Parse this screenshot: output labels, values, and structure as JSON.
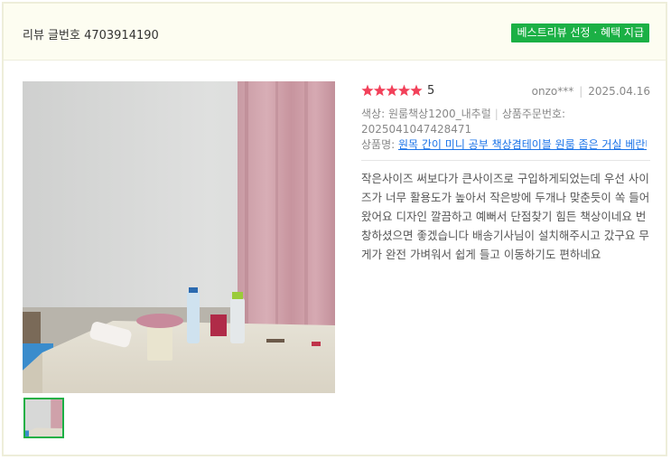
{
  "header": {
    "review_number": "리뷰 글번호 4703914190",
    "best_badge": "베스트리뷰 선정 · 혜택 지급"
  },
  "review": {
    "rating_value": 5,
    "rating_text": "5",
    "star_color": "#f2415a",
    "author": "onzo***",
    "date": "2025.04.16",
    "option_text": "색상: 원룸책상1200_내추럴",
    "order_label": "상품주문번호:",
    "order_number": "2025041047428471",
    "product_label": "상품명:",
    "product_name": "원목 간이 미니 공부 책상겸테이블 원룸 좁은 거실 베란다 1인용",
    "content": "작은사이즈 써보다가 큰사이즈로 구입하게되었는데 우선 사이즈가 너무 활용도가 높아서 작은방에 두개나 맞춘듯이 쏙 들어왔어요 디자인 깔끔하고 예뻐서 단점찾기 힘든 책상이네요 번창하셨으면 좋겠습니다 배송기사님이 설치해주시고 갔구요 무게가 완전 가벼워서 쉽게 들고 이동하기도 편하네요"
  },
  "colors": {
    "accent_green": "#1bb045",
    "link_blue": "#1a73e8"
  },
  "icons": [
    "star-icon"
  ]
}
